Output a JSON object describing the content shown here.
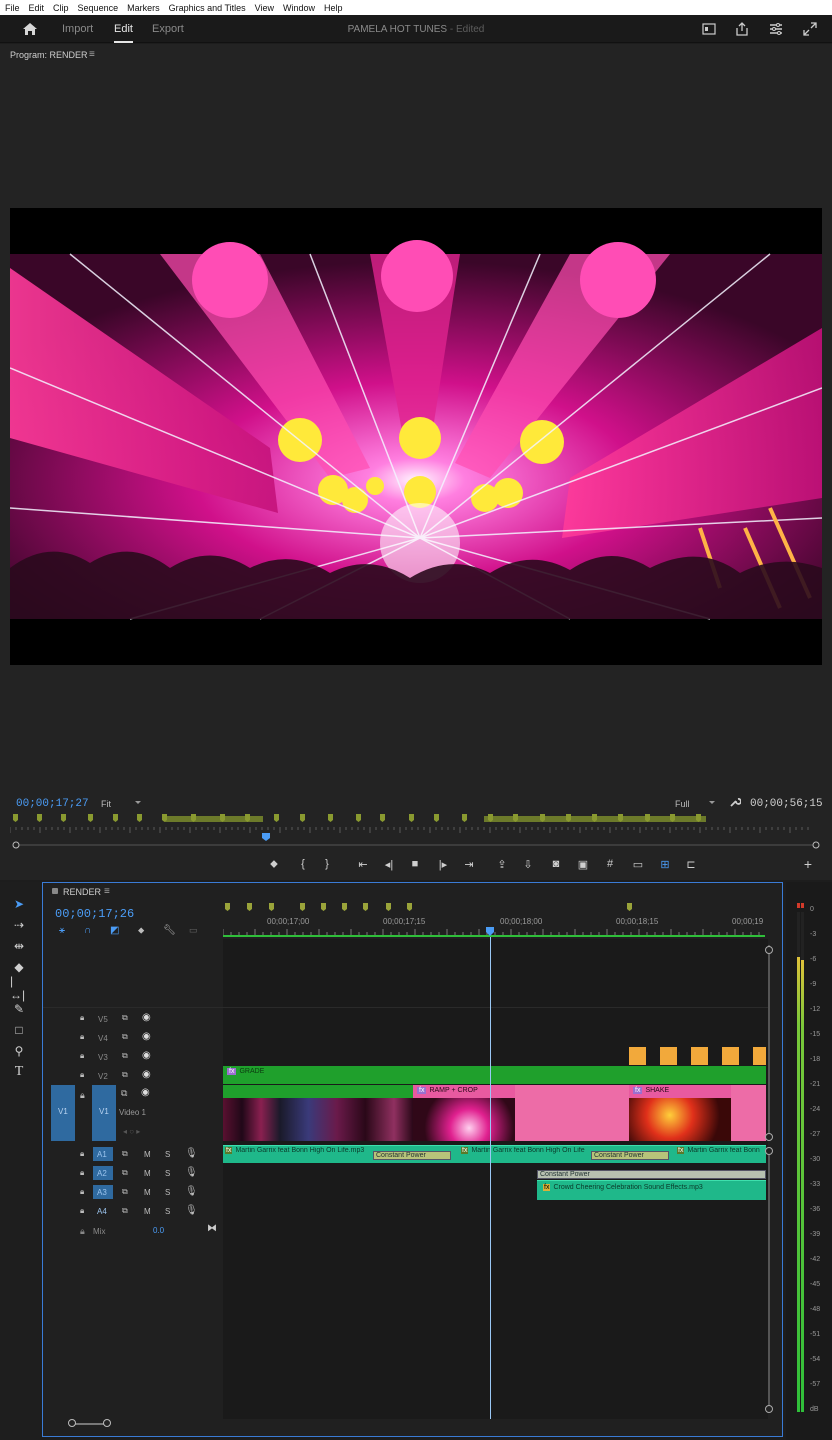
{
  "menu": [
    "File",
    "Edit",
    "Clip",
    "Sequence",
    "Markers",
    "Graphics and Titles",
    "View",
    "Window",
    "Help"
  ],
  "header": {
    "tabs": [
      "Import",
      "Edit",
      "Export"
    ],
    "active_tab": "Edit",
    "project": "PAMELA HOT TUNES",
    "edited": " - Edited"
  },
  "program": {
    "label": "Program: RENDER",
    "timecode": "00;00;17;27",
    "fit": "Fit",
    "quality": "Full",
    "duration": "00;00;56;15"
  },
  "timeline": {
    "sequence": "RENDER",
    "timecode": "00;00;17;26",
    "ruler": [
      "00;00;17;00",
      "00;00;17;15",
      "00;00;18;00",
      "00;00;18;15",
      "00;00;19"
    ],
    "video_tracks": [
      "V5",
      "V4",
      "V3",
      "V2",
      "V1"
    ],
    "v1_source": "V1",
    "v1_name": "Video 1",
    "audio_tracks": [
      "A1",
      "A2",
      "A3",
      "A4"
    ],
    "mix_label": "Mix",
    "mix_value": "0.0",
    "clips": {
      "grade": "GRADE",
      "ramp": "RAMP + CROP",
      "shake": "SHAKE",
      "a1_1": "Martin Garrix feat Bonn  High On Life.mp3",
      "a1_2": "Martin Garrix feat Bonn  High On Life",
      "a1_3": "Martin Garrix feat Bonn",
      "trans1": "Constant Power",
      "trans2": "Constant Power",
      "trans3": "Constant Power",
      "a3_clip": "Crowd Cheering  Celebration  Sound Effects.mp3"
    },
    "meter_scale": [
      "0",
      "-3",
      "-6",
      "-9",
      "-12",
      "-15",
      "-18",
      "-21",
      "-24",
      "-27",
      "-30",
      "-33",
      "-36",
      "-39",
      "-42",
      "-45",
      "-48",
      "-51",
      "-54",
      "-57",
      "dB"
    ]
  },
  "colors": {
    "accent": "#4b9cf5",
    "video_clip": "#ed6ca7",
    "audio_clip": "#1fb88a",
    "grade_clip": "#1fa02c",
    "marker": "#f2a93b"
  }
}
